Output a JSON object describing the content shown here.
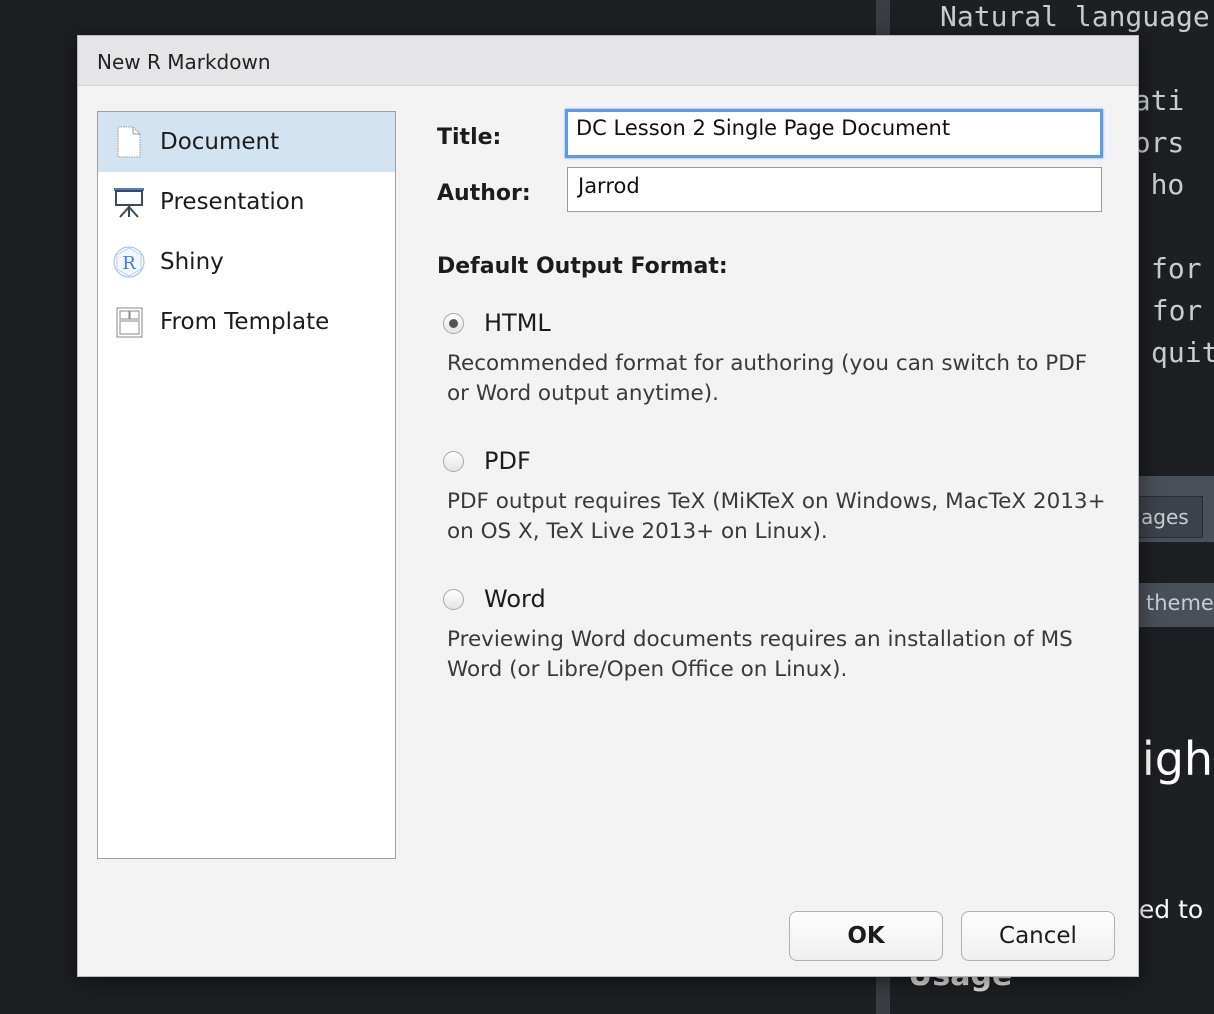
{
  "background": {
    "lines": [
      "Natural language",
      "orati",
      "utors",
      "on ho",
      "for",
      "' for",
      "quit"
    ],
    "tab": "ages",
    "theme": "theme",
    "heading": "hligh",
    "text": "used to",
    "subheading": "Usage"
  },
  "dialog": {
    "title": "New R Markdown",
    "sidebar": [
      {
        "label": "Document",
        "icon": "document-icon",
        "selected": true
      },
      {
        "label": "Presentation",
        "icon": "presentation-icon"
      },
      {
        "label": "Shiny",
        "icon": "shiny-icon"
      },
      {
        "label": "From Template",
        "icon": "template-icon"
      }
    ],
    "title_label": "Title:",
    "title_value": "DC Lesson 2 Single Page Document",
    "author_label": "Author:",
    "author_value": "Jarrod",
    "format_label": "Default Output Format:",
    "formats": [
      {
        "label": "HTML",
        "selected": true,
        "desc": "Recommended format for authoring (you can switch to PDF or Word output anytime)."
      },
      {
        "label": "PDF",
        "selected": false,
        "desc": "PDF output requires TeX (MiKTeX on Windows, MacTeX 2013+ on OS X, TeX Live 2013+ on Linux)."
      },
      {
        "label": "Word",
        "selected": false,
        "desc": "Previewing Word documents requires an installation of MS Word (or Libre/Open Office on Linux)."
      }
    ],
    "ok": "OK",
    "cancel": "Cancel",
    "focus_color": "#5d9ae8",
    "selection_color": "#d3e3f0"
  }
}
